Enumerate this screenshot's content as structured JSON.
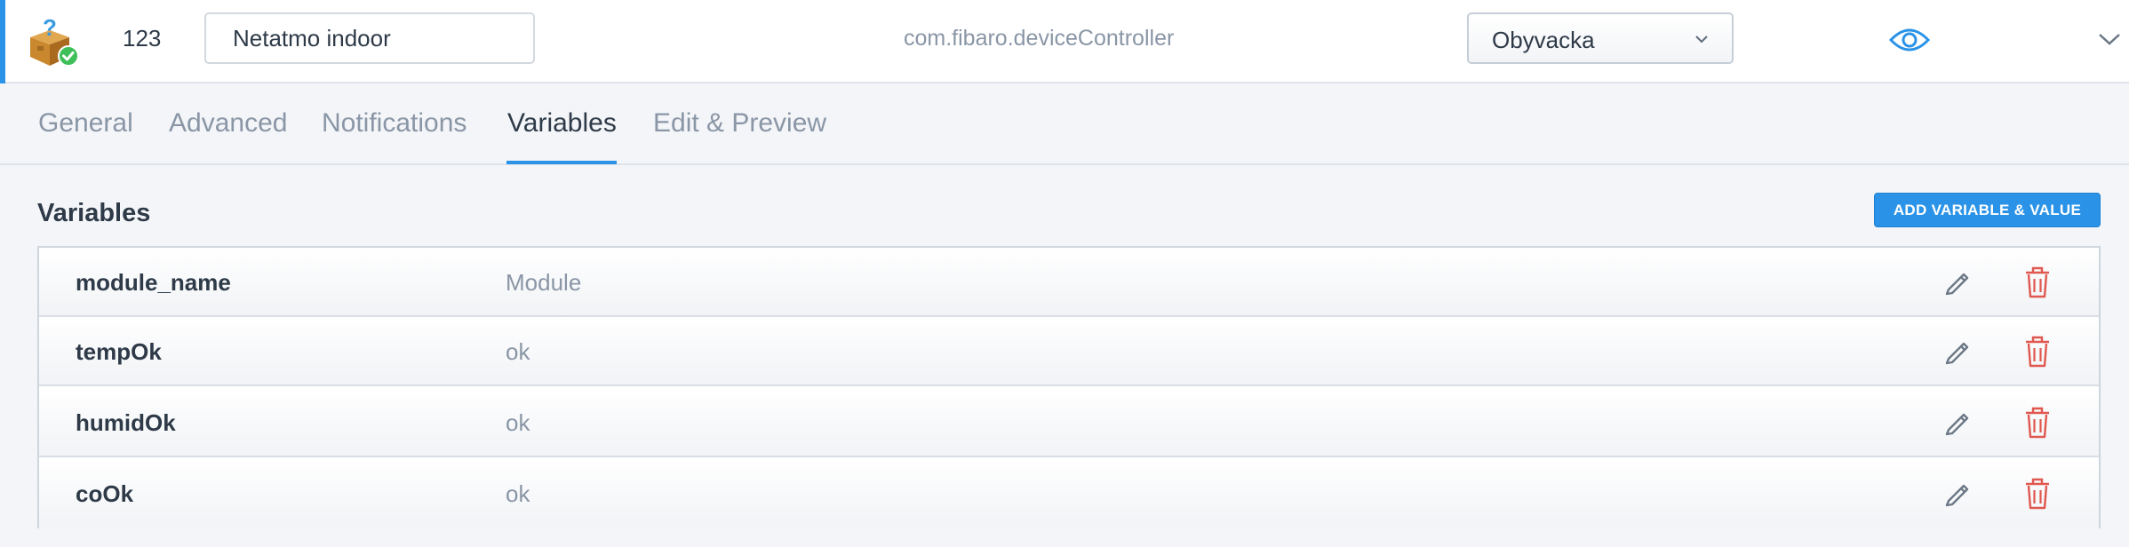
{
  "device": {
    "icon": "package-question-icon",
    "status_icon": "check-badge-icon",
    "id": "123",
    "name": "Netatmo indoor",
    "type": "com.fibaro.deviceController",
    "room": "Obyvacka",
    "visibility_icon": "eye-icon",
    "collapse_icon": "chevron-down-icon"
  },
  "tabs": [
    {
      "label": "General"
    },
    {
      "label": "Advanced"
    },
    {
      "label": "Notifications"
    },
    {
      "label": "Variables",
      "active": true
    },
    {
      "label": "Edit & Preview"
    }
  ],
  "variables": {
    "title": "Variables",
    "add_button": "ADD VARIABLE & VALUE",
    "rows": [
      {
        "name": "module_name",
        "value": "Module"
      },
      {
        "name": "tempOk",
        "value": "ok"
      },
      {
        "name": "humidOk",
        "value": "ok"
      },
      {
        "name": "coOk",
        "value": "ok"
      }
    ],
    "row_actions": [
      "pencil-icon",
      "trash-icon"
    ]
  },
  "colors": {
    "accent": "#2a93e8",
    "delete": "#e0574f",
    "text": "#2e3a48",
    "muted": "#8a96a6",
    "background": "#f3f5f8"
  }
}
